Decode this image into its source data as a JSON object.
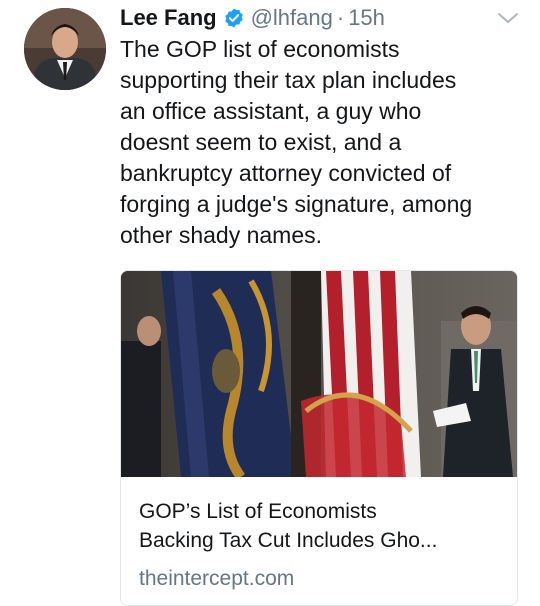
{
  "tweet": {
    "author_name": "Lee Fang",
    "handle": "@lhfang",
    "separator": "·",
    "time": "15h",
    "text": "The GOP list of economists\nsupporting their tax plan includes\nan office assistant, a guy who\ndoesnt seem to exist, and a\nbankruptcy attorney convicted of\nforging a judge's signature, among\nother shady names."
  },
  "card": {
    "title": "GOP’s List of Economists\nBacking Tax Cut Includes Gho...",
    "domain": "theintercept.com"
  },
  "colors": {
    "text": "#14171a",
    "secondary": "#657786",
    "verified": "#1da1f2",
    "border": "#e1e8ed"
  }
}
